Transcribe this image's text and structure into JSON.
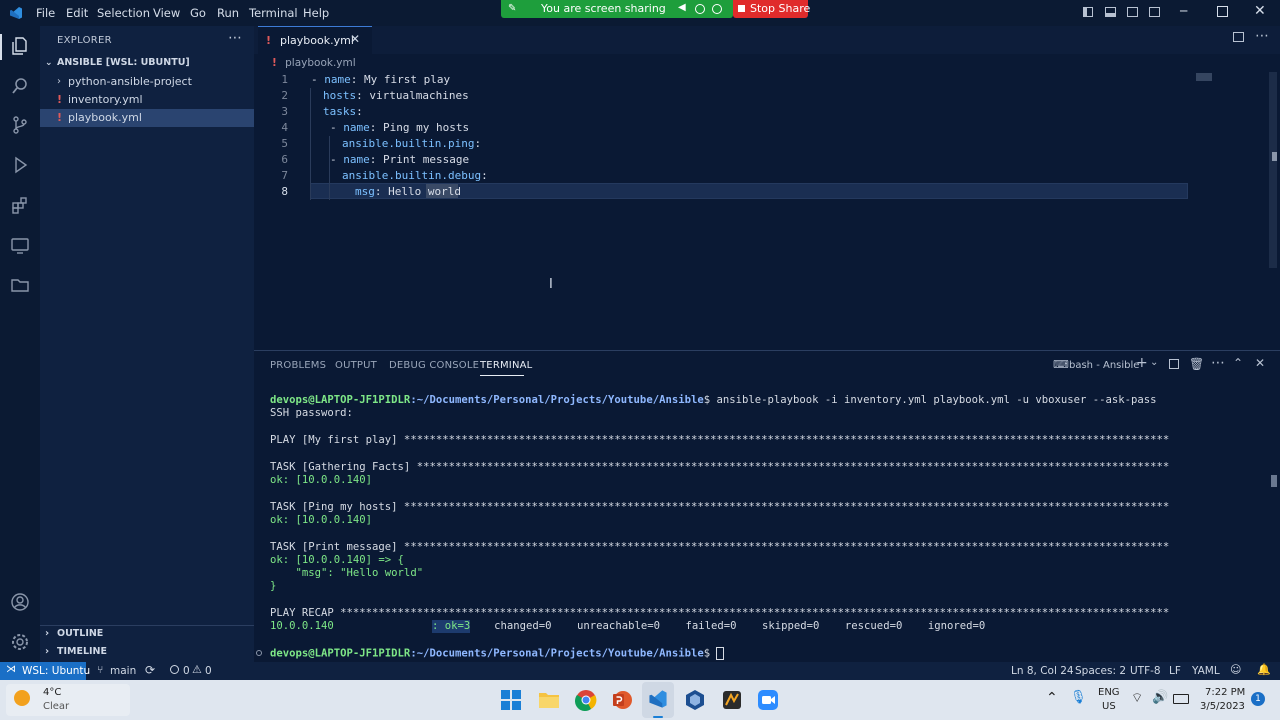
{
  "menu": [
    "File",
    "Edit",
    "Selection",
    "View",
    "Go",
    "Run",
    "Terminal",
    "Help"
  ],
  "share": {
    "status": "You are screen sharing",
    "stop": "Stop Share"
  },
  "sidebar": {
    "title": "EXPLORER",
    "workspace": "ANSIBLE [WSL: UBUNTU]",
    "items": [
      {
        "label": "python-ansible-project",
        "type": "folder"
      },
      {
        "label": "inventory.yml",
        "type": "file"
      },
      {
        "label": "playbook.yml",
        "type": "file",
        "selected": true
      }
    ],
    "outline": "OUTLINE",
    "timeline": "TIMELINE"
  },
  "editor": {
    "tab": "playbook.yml",
    "breadcrumb": "playbook.yml",
    "lines": [
      {
        "n": "1",
        "indent": "",
        "dash": "- ",
        "key": "name",
        "val": "My first play"
      },
      {
        "n": "2",
        "indent": "  ",
        "dash": "",
        "key": "hosts",
        "val": "virtualmachines"
      },
      {
        "n": "3",
        "indent": "  ",
        "dash": "",
        "key": "tasks",
        "val": ""
      },
      {
        "n": "4",
        "indent": "    ",
        "dash": "- ",
        "key": "name",
        "val": "Ping my hosts"
      },
      {
        "n": "5",
        "indent": "      ",
        "dash": "",
        "key": "ansible.builtin.ping",
        "val": ""
      },
      {
        "n": "6",
        "indent": "    ",
        "dash": "- ",
        "key": "name",
        "val": "Print message"
      },
      {
        "n": "7",
        "indent": "      ",
        "dash": "",
        "key": "ansible.builtin.debug",
        "val": ""
      },
      {
        "n": "8",
        "indent": "        ",
        "dash": "",
        "key": "msg",
        "val": "Hello world"
      }
    ]
  },
  "panel": {
    "tabs": [
      "PROBLEMS",
      "OUTPUT",
      "DEBUG CONSOLE",
      "TERMINAL"
    ],
    "active": "TERMINAL",
    "shell": "bash - Ansible",
    "prompt_user": "devops@LAPTOP-JF1PIDLR",
    "prompt_path": ":~/Documents/Personal/Projects/Youtube/Ansible",
    "command": "$ ansible-playbook -i inventory.yml playbook.yml -u vboxuser --ask-pass",
    "ssh": "SSH password:",
    "play": "PLAY [My first play] ************************************************************************************************************************",
    "task1": "TASK [Gathering Facts] **********************************************************************************************************************",
    "ok1": "ok: [10.0.0.140]",
    "task2": "TASK [Ping my hosts] ************************************************************************************************************************",
    "ok2": "ok: [10.0.0.140]",
    "task3": "TASK [Print message] ************************************************************************************************************************",
    "ok3": "ok: [10.0.0.140] => {",
    "msg": "    \"msg\": \"Hello world\"",
    "close": "}",
    "recap": "PLAY RECAP **********************************************************************************************************************************",
    "recap_host": "10.0.0.140",
    "recap_ok": ": ok=3",
    "recap_rest": "   changed=0    unreachable=0    failed=0    skipped=0    rescued=0    ignored=0",
    "final_prompt_end": "$ "
  },
  "status": {
    "remote": "WSL: Ubuntu",
    "branch": "main",
    "errors": "0",
    "warnings": "0",
    "position": "Ln 8, Col 24",
    "spaces": "Spaces: 2",
    "encoding": "UTF-8",
    "eol": "LF",
    "language": "YAML"
  },
  "taskbar": {
    "temp": "4°C",
    "weather": "Clear",
    "lang1": "ENG",
    "lang2": "US",
    "time": "7:22 PM",
    "date": "3/5/2023",
    "notif": "1"
  },
  "colors": {
    "accent": "#3d7bd6",
    "share": "#1e9e3c",
    "stop": "#e02b2b",
    "statusRemote": "#1a6fc6"
  }
}
